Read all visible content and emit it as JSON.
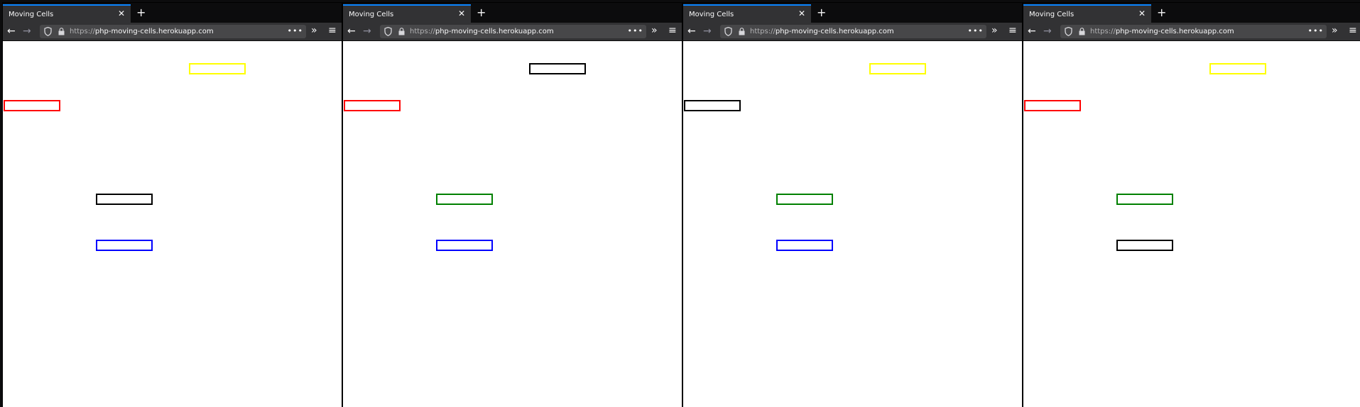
{
  "windows": [
    {
      "tab_title": "Moving Cells",
      "url": {
        "prefix": "https://",
        "host": "php-moving-cells.herokuapp.com"
      },
      "cells": [
        {
          "name": "cell-top-right",
          "color": "#ffff00"
        },
        {
          "name": "cell-left",
          "color": "#ff0000"
        },
        {
          "name": "cell-middle",
          "color": "#000000"
        },
        {
          "name": "cell-bottom",
          "color": "#0000ff"
        }
      ]
    },
    {
      "tab_title": "Moving Cells",
      "url": {
        "prefix": "https://",
        "host": "php-moving-cells.herokuapp.com"
      },
      "cells": [
        {
          "name": "cell-top-right",
          "color": "#000000"
        },
        {
          "name": "cell-left",
          "color": "#ff0000"
        },
        {
          "name": "cell-middle",
          "color": "#008000"
        },
        {
          "name": "cell-bottom",
          "color": "#0000ff"
        }
      ]
    },
    {
      "tab_title": "Moving Cells",
      "url": {
        "prefix": "https://",
        "host": "php-moving-cells.herokuapp.com"
      },
      "cells": [
        {
          "name": "cell-top-right",
          "color": "#ffff00"
        },
        {
          "name": "cell-left",
          "color": "#000000"
        },
        {
          "name": "cell-middle",
          "color": "#008000"
        },
        {
          "name": "cell-bottom",
          "color": "#0000ff"
        }
      ]
    },
    {
      "tab_title": "Moving Cells",
      "url": {
        "prefix": "https://",
        "host": "php-moving-cells.herokuapp.com"
      },
      "cells": [
        {
          "name": "cell-top-right",
          "color": "#ffff00"
        },
        {
          "name": "cell-left",
          "color": "#ff0000"
        },
        {
          "name": "cell-middle",
          "color": "#008000"
        },
        {
          "name": "cell-bottom",
          "color": "#000000"
        }
      ]
    }
  ],
  "icons": {
    "back": "back-arrow-icon",
    "forward": "forward-arrow-icon",
    "close": "close-icon",
    "new_tab": "plus-icon",
    "shield": "shield-icon",
    "lock": "lock-icon",
    "page_actions": "ellipsis-icon",
    "overflow": "double-chevron-icon",
    "menu": "hamburger-menu-icon"
  }
}
